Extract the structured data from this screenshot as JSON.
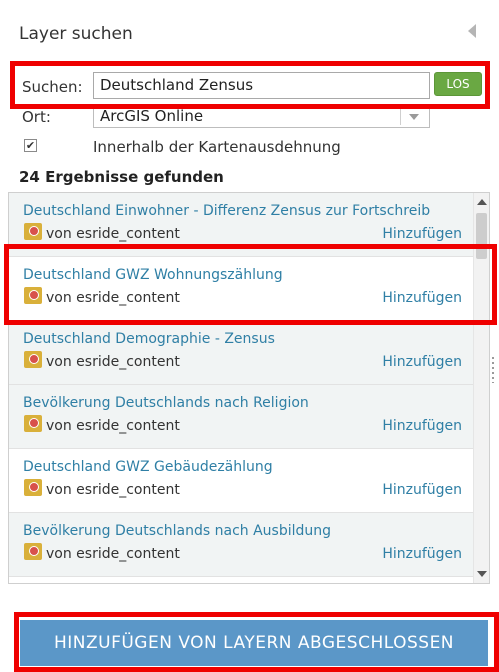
{
  "panel": {
    "title": "Layer suchen",
    "collapse_icon": "collapse-left-icon"
  },
  "search": {
    "label": "Suchen:",
    "value": "Deutschland Zensus",
    "go_label": "LOS"
  },
  "location": {
    "label": "Ort:",
    "selected": "ArcGIS Online"
  },
  "extent_filter": {
    "checked": true,
    "label": "Innerhalb der Kartenausdehnung"
  },
  "results": {
    "count_text": "24 Ergebnisse gefunden",
    "items": [
      {
        "name": "Deutschland Einwohner - Differenz Zensus zur Fortschreib",
        "by": "von esride_content",
        "add": "Hinzufügen"
      },
      {
        "name": "Deutschland GWZ Wohnungszählung",
        "by": "von esride_content",
        "add": "Hinzufügen"
      },
      {
        "name": "Deutschland Demographie - Zensus",
        "by": "von esride_content",
        "add": "Hinzufügen"
      },
      {
        "name": "Bevölkerung Deutschlands nach Religion",
        "by": "von esride_content",
        "add": "Hinzufügen"
      },
      {
        "name": "Deutschland GWZ Gebäudezählung",
        "by": "von esride_content",
        "add": "Hinzufügen"
      },
      {
        "name": "Bevölkerung Deutschlands nach Ausbildung",
        "by": "von esride_content",
        "add": "Hinzufügen"
      }
    ]
  },
  "footer": {
    "done_label": "HINZUFÜGEN VON LAYERN ABGESCHLOSSEN"
  },
  "colors": {
    "link": "#2f7fa5",
    "go_button": "#6aa843",
    "done_button": "#5b97c8",
    "highlight": "#ef0000"
  }
}
